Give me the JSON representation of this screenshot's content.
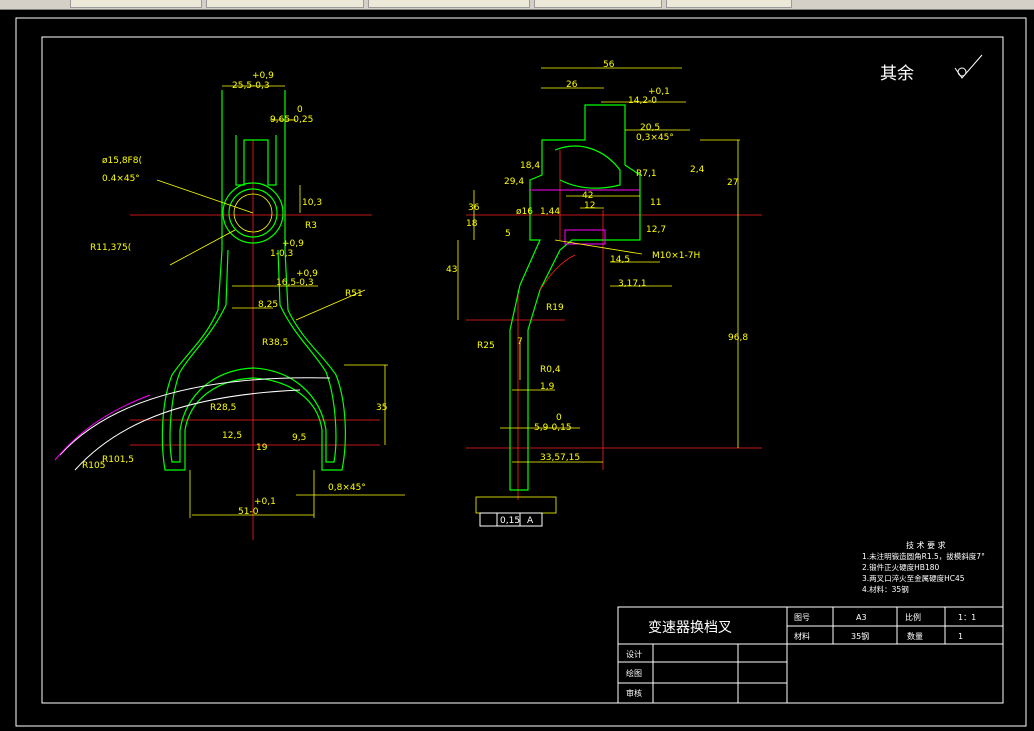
{
  "surface_finish": {
    "label": "其余"
  },
  "title_block": {
    "part_name": "变速器换档叉",
    "drawing_no_label": "图号",
    "drawing_no_value": "A3",
    "scale_label": "比例",
    "scale_value": "1：1",
    "material_label": "材料",
    "material_value": "35钢",
    "quantity_label": "数量",
    "quantity_value": "1",
    "design_label": "设计",
    "drawn_label": "绘图",
    "review_label": "审核"
  },
  "tech_req": {
    "title": "技 术 要 求",
    "items": [
      "1.未注明锻造圆角R1.5，拔模斜度7°",
      "2.锻件正火硬度HB180",
      "3.两叉口淬火至金属硬度HC45",
      "4.材料：35钢"
    ]
  },
  "left_view_dims": {
    "d_25_5": "25,5-0,3",
    "d_25_5_tol": "+0,9",
    "d_9_65": "9,65-0,25",
    "d_9_65_tol": "0",
    "d_15_8": "ø15,8F8(",
    "d_045": "0.4×45°",
    "d_r11": "R11,375(",
    "d_10_3": "10,3",
    "d_r3": "R3",
    "d_tol09": "+0,9",
    "d_1_03": "1-0,3",
    "d_16_5_tol": "+0,9",
    "d_16_5": "16,5-0,3",
    "d_8_25": "8,25",
    "d_r51": "R51",
    "d_r38": "R38,5",
    "d_r28": "R28,5",
    "d_35": "35",
    "d_12_5": "12,5",
    "d_19": "19",
    "d_9_5": "9,5",
    "d_r101": "R101,5",
    "d_r105": "R105",
    "d_51": "51-0",
    "d_51_tol": "+0,1",
    "d_08x45": "0,8×45°"
  },
  "right_view_dims": {
    "d_56": "56",
    "d_26": "26",
    "d_14_2_tol": "+0,1",
    "d_14_2": "14,2-0",
    "d_20_5": "20,5",
    "d_03x45": "0,3×45°",
    "d_r7": "R7,1",
    "d_2_4": "2,4",
    "d_27": "27",
    "d_29_4": "29,4",
    "d_18_4": "18,4",
    "d_42": "42",
    "d_12": "12",
    "d_11": "11",
    "d_36": "36",
    "d_18": "18",
    "d_5": "5",
    "d_phi16": "ø16",
    "d_1_44": "1,44",
    "d_12_7": "12,7",
    "d_m10": "M10×1-7H",
    "d_14_5": "14,5",
    "d_3_17": "3,17,1",
    "d_43": "43",
    "d_r19": "R19",
    "d_96_8": "96,8",
    "d_r25": "R25",
    "d_7": "7",
    "d_r04": "R0,4",
    "d_1_9": "1,9",
    "d_5_9_tol": "0",
    "d_5_9": "5,9-0,15",
    "d_33": "33,57,15",
    "tol_val": "0,15",
    "tol_datum": "A"
  },
  "colors": {
    "background": "#000000",
    "outline": "#ffffff",
    "part": "#00ff00",
    "dimension": "#ffff00",
    "centerline": "#ff2020",
    "hidden": "#ff00ff"
  }
}
